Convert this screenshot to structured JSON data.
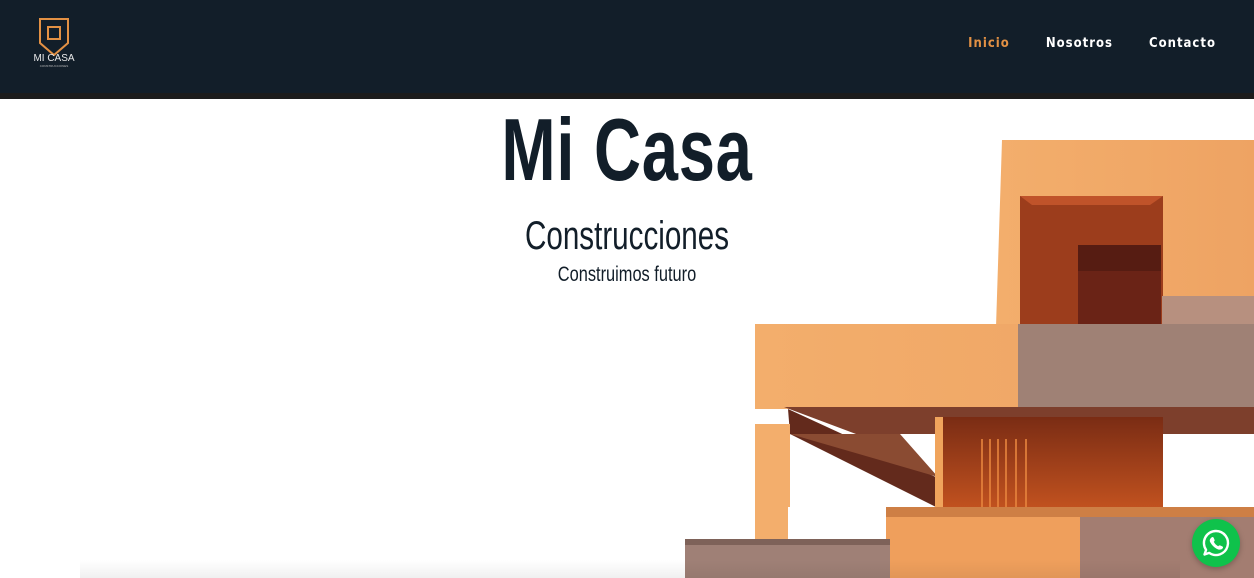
{
  "header": {
    "logo": {
      "name": "MI CASA",
      "sub": "CONSTRUCCIONES",
      "icon": "house-logo-icon"
    },
    "nav": [
      {
        "label": "Inicio",
        "active": true
      },
      {
        "label": "Nosotros",
        "active": false
      },
      {
        "label": "Contacto",
        "active": false
      }
    ]
  },
  "hero": {
    "title": "Mi Casa",
    "subtitle": "Construcciones",
    "tagline": "Construimos futuro",
    "image": "modern-building-photo"
  },
  "whatsapp": {
    "icon": "whatsapp-icon"
  },
  "colors": {
    "header_bg": "#121e29",
    "accent": "#e39144",
    "text_dark": "#121e29",
    "whatsapp_green": "#0fc24b"
  }
}
